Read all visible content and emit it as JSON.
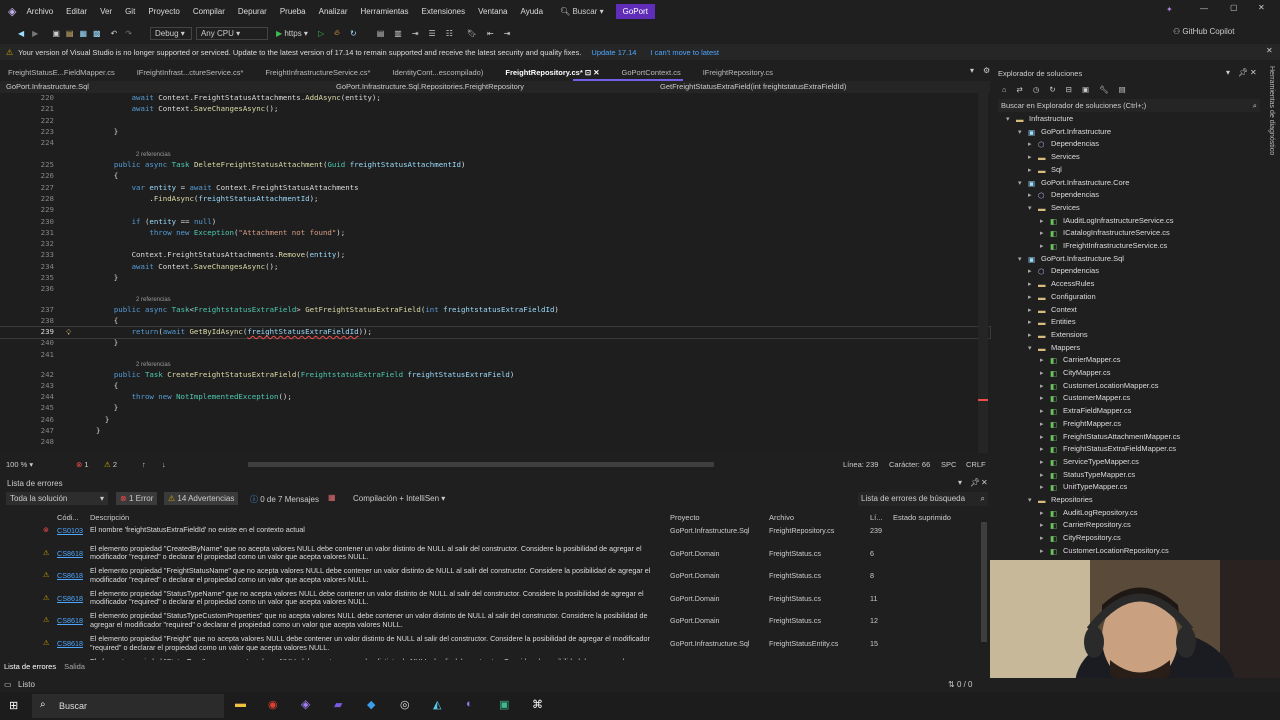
{
  "menu": [
    "Archivo",
    "Editar",
    "Ver",
    "Git",
    "Proyecto",
    "Compilar",
    "Depurar",
    "Prueba",
    "Analizar",
    "Herramientas",
    "Extensiones",
    "Ventana",
    "Ayuda"
  ],
  "search_label": "Buscar",
  "solution_name": "GoPort",
  "toolbar": {
    "config": "Debug",
    "platform": "Any CPU",
    "run": "https",
    "copilot": "GitHub Copilot"
  },
  "infobar": {
    "message": "Your version of Visual Studio is no longer supported or serviced. Update to the latest version of 17.14 to remain supported and receive the latest security and quality fixes.",
    "update": "Update 17.14",
    "cant_move": "I can't move to latest"
  },
  "doc_tabs": [
    "FreightStatusE...FieldMapper.cs",
    "IFreightInfrast...ctureService.cs*",
    "FreightInfrastructureService.cs*",
    "IdentityCont...escompilado)",
    "FreightRepository.cs*",
    "GoPortContext.cs",
    "IFreightRepository.cs"
  ],
  "nav": {
    "project": "GoPort.Infrastructure.Sql",
    "class": "GoPort.Infrastructure.Sql.Repositories.FreightRepository",
    "member": "GetFreightStatusExtraField(int freightstatusExtraFieldId)"
  },
  "code_refs": "2 referencias",
  "editor_status": {
    "zoom": "100 %",
    "errors": "1",
    "warnings": "2",
    "line": "Línea: 239",
    "char": "Carácter: 66",
    "spc": "SPC",
    "crlf": "CRLF"
  },
  "error_list": {
    "title": "Lista de errores",
    "scope": "Toda la solución",
    "errors_btn": "1 Error",
    "warnings_btn": "14 Advertencias",
    "messages_btn": "0 de 7 Mensajes",
    "build_filter": "Compilación + IntelliSen",
    "search": "Lista de errores de búsqueda",
    "headers": [
      "Códi...",
      "Descripción",
      "Proyecto",
      "Archivo",
      "Lí...",
      "Estado suprimido"
    ],
    "rows": [
      {
        "type": "error",
        "code": "CS0103",
        "desc": "El nombre 'freightStatusExtraFieldId' no existe en el contexto actual",
        "project": "GoPort.Infrastructure.Sql",
        "file": "FreightRepository.cs",
        "line": "239"
      },
      {
        "type": "warning",
        "code": "CS8618",
        "desc": "El elemento propiedad \"CreatedByName\" que no acepta valores NULL debe contener un valor distinto de NULL al salir del constructor. Considere la posibilidad de agregar el modificador \"required\" o declarar el propiedad como un valor que acepta valores NULL.",
        "project": "GoPort.Domain",
        "file": "FreightStatus.cs",
        "line": "6"
      },
      {
        "type": "warning",
        "code": "CS8618",
        "desc": "El elemento propiedad \"FreightStatusName\" que no acepta valores NULL debe contener un valor distinto de NULL al salir del constructor. Considere la posibilidad de agregar el modificador \"required\" o declarar el propiedad como un valor que acepta valores NULL.",
        "project": "GoPort.Domain",
        "file": "FreightStatus.cs",
        "line": "8"
      },
      {
        "type": "warning",
        "code": "CS8618",
        "desc": "El elemento propiedad \"StatusTypeName\" que no acepta valores NULL debe contener un valor distinto de NULL al salir del constructor. Considere la posibilidad de agregar el modificador \"required\" o declarar el propiedad como un valor que acepta valores NULL.",
        "project": "GoPort.Domain",
        "file": "FreightStatus.cs",
        "line": "11"
      },
      {
        "type": "warning",
        "code": "CS8618",
        "desc": "El elemento propiedad \"StatusTypeCustomProperties\" que no acepta valores NULL debe contener un valor distinto de NULL al salir del constructor. Considere la posibilidad de agregar el modificador \"required\" o declarar el propiedad como un valor que acepta valores NULL.",
        "project": "GoPort.Domain",
        "file": "FreightStatus.cs",
        "line": "12"
      },
      {
        "type": "warning",
        "code": "CS8618",
        "desc": "El elemento propiedad \"Freight\" que no acepta valores NULL debe contener un valor distinto de NULL al salir del constructor. Considere la posibilidad de agregar el modificador \"required\" o declarar el propiedad como un valor que acepta valores NULL.",
        "project": "GoPort.Infrastructure.Sql",
        "file": "FreightStatusEntity.cs",
        "line": "15"
      },
      {
        "type": "warning",
        "code": "CS8618",
        "desc": "El elemento propiedad \"StatusType\" que no acepta valores NULL debe contener un valor distinto de NULL al salir del constructor. Considere la posibilidad de agregar el",
        "project": "GoPort.Infrastructure.Sql",
        "file": "FreightStatusEntity.cs",
        "line": "16"
      }
    ],
    "bottom_tabs": [
      "Lista de errores",
      "Salida"
    ]
  },
  "solution_explorer": {
    "title": "Explorador de soluciones",
    "search": "Buscar en Explorador de soluciones (Ctrl+;)",
    "nodes": [
      {
        "label": "Infrastructure",
        "indent": 0,
        "kind": "folder",
        "arrow": "▾"
      },
      {
        "label": "GoPort.Infrastructure",
        "indent": 1,
        "kind": "project",
        "arrow": "▾"
      },
      {
        "label": "Dependencias",
        "indent": 2,
        "kind": "dep",
        "arrow": "▸"
      },
      {
        "label": "Services",
        "indent": 2,
        "kind": "folder",
        "arrow": "▸"
      },
      {
        "label": "Sql",
        "indent": 2,
        "kind": "folder",
        "arrow": "▸"
      },
      {
        "label": "GoPort.Infrastructure.Core",
        "indent": 1,
        "kind": "project",
        "arrow": "▾"
      },
      {
        "label": "Dependencias",
        "indent": 2,
        "kind": "dep",
        "arrow": "▸"
      },
      {
        "label": "Services",
        "indent": 2,
        "kind": "folder",
        "arrow": "▾"
      },
      {
        "label": "IAuditLogInfrastructureService.cs",
        "indent": 3,
        "kind": "cs",
        "arrow": "▸"
      },
      {
        "label": "ICatalogInfrastructureService.cs",
        "indent": 3,
        "kind": "cs",
        "arrow": "▸"
      },
      {
        "label": "IFreightInfrastructureService.cs",
        "indent": 3,
        "kind": "cs",
        "arrow": "▸"
      },
      {
        "label": "GoPort.Infrastructure.Sql",
        "indent": 1,
        "kind": "project",
        "arrow": "▾"
      },
      {
        "label": "Dependencias",
        "indent": 2,
        "kind": "dep",
        "arrow": "▸"
      },
      {
        "label": "AccessRules",
        "indent": 2,
        "kind": "folder",
        "arrow": "▸"
      },
      {
        "label": "Configuration",
        "indent": 2,
        "kind": "folder",
        "arrow": "▸"
      },
      {
        "label": "Context",
        "indent": 2,
        "kind": "folder",
        "arrow": "▸"
      },
      {
        "label": "Entities",
        "indent": 2,
        "kind": "folder",
        "arrow": "▸"
      },
      {
        "label": "Extensions",
        "indent": 2,
        "kind": "folder",
        "arrow": "▸"
      },
      {
        "label": "Mappers",
        "indent": 2,
        "kind": "folder",
        "arrow": "▾"
      },
      {
        "label": "CarrierMapper.cs",
        "indent": 3,
        "kind": "cs",
        "arrow": "▸"
      },
      {
        "label": "CityMapper.cs",
        "indent": 3,
        "kind": "cs",
        "arrow": "▸"
      },
      {
        "label": "CustomerLocationMapper.cs",
        "indent": 3,
        "kind": "cs",
        "arrow": "▸"
      },
      {
        "label": "CustomerMapper.cs",
        "indent": 3,
        "kind": "cs",
        "arrow": "▸"
      },
      {
        "label": "ExtraFieldMapper.cs",
        "indent": 3,
        "kind": "cs",
        "arrow": "▸"
      },
      {
        "label": "FreightMapper.cs",
        "indent": 3,
        "kind": "cs",
        "arrow": "▸"
      },
      {
        "label": "FreightStatusAttachmentMapper.cs",
        "indent": 3,
        "kind": "cs",
        "arrow": "▸"
      },
      {
        "label": "FreightStatusExtraFieldMapper.cs",
        "indent": 3,
        "kind": "cs",
        "arrow": "▸"
      },
      {
        "label": "ServiceTypeMapper.cs",
        "indent": 3,
        "kind": "cs",
        "arrow": "▸"
      },
      {
        "label": "StatusTypeMapper.cs",
        "indent": 3,
        "kind": "cs",
        "arrow": "▸"
      },
      {
        "label": "UnitTypeMapper.cs",
        "indent": 3,
        "kind": "cs",
        "arrow": "▸"
      },
      {
        "label": "Repositories",
        "indent": 2,
        "kind": "folder",
        "arrow": "▾"
      },
      {
        "label": "AuditLogRepository.cs",
        "indent": 3,
        "kind": "cs",
        "arrow": "▸"
      },
      {
        "label": "CarrierRepository.cs",
        "indent": 3,
        "kind": "cs",
        "arrow": "▸"
      },
      {
        "label": "CityRepository.cs",
        "indent": 3,
        "kind": "cs",
        "arrow": "▸"
      },
      {
        "label": "CustomerLocationRepository.cs",
        "indent": 3,
        "kind": "cs",
        "arrow": "▸"
      }
    ]
  },
  "side_tab": "Herramientas de diagnóstico",
  "status": {
    "ready": "Listo",
    "counter": "0 / 0"
  },
  "taskbar": {
    "search": "Buscar"
  },
  "colors": {
    "accent": "#0e639c",
    "error": "#f14c4c",
    "warning": "#cca700",
    "keyword": "#569cd6",
    "type": "#4ec9b0",
    "method": "#dcdcaa",
    "string": "#d69d85",
    "param": "#9cdcfe"
  }
}
